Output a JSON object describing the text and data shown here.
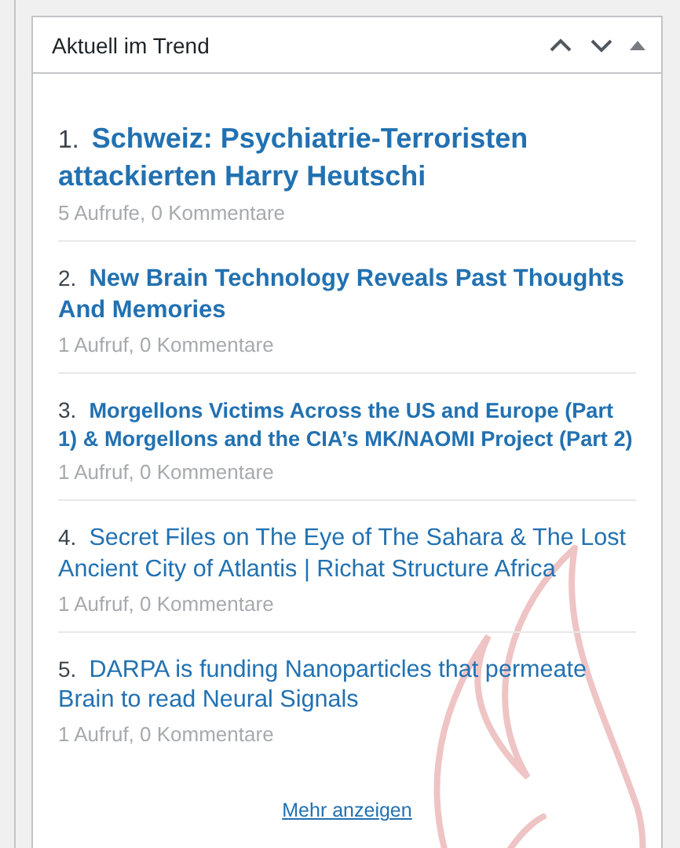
{
  "widget": {
    "title": "Aktuell im Trend",
    "expanded": true
  },
  "posts": [
    {
      "number": "1.",
      "title": "Schweiz: Psychiatrie-Terroristen attackierten Harry Heutschi",
      "kind": "large",
      "meta": "5 Aufrufe, 0 Kommentare"
    },
    {
      "number": "2.",
      "title": "New Brain Technology Reveals Past Thoughts And Memories",
      "kind": "medium",
      "meta": "1 Aufruf, 0 Kommentare"
    },
    {
      "number": "3.",
      "title": "Morgellons Victims Across the US and Europe (Part 1) & Morgellons and the CIA’s MK/NAOMI Project (Part 2)",
      "kind": "small",
      "meta": "1 Aufruf, 0 Kommentare"
    },
    {
      "number": "4.",
      "title": "Secret Files on The Eye of The Sahara & The Lost Ancient City of Atlantis | Richat Structure Africa",
      "kind": "plain",
      "meta": "1 Aufruf, 0 Kommentare"
    },
    {
      "number": "5.",
      "title": "DARPA is funding Nanoparticles that permeate Brain to read Neural Signals",
      "kind": "plain",
      "meta": "1 Aufruf, 0 Kommentare"
    }
  ],
  "more_link": "Mehr anzeigen"
}
